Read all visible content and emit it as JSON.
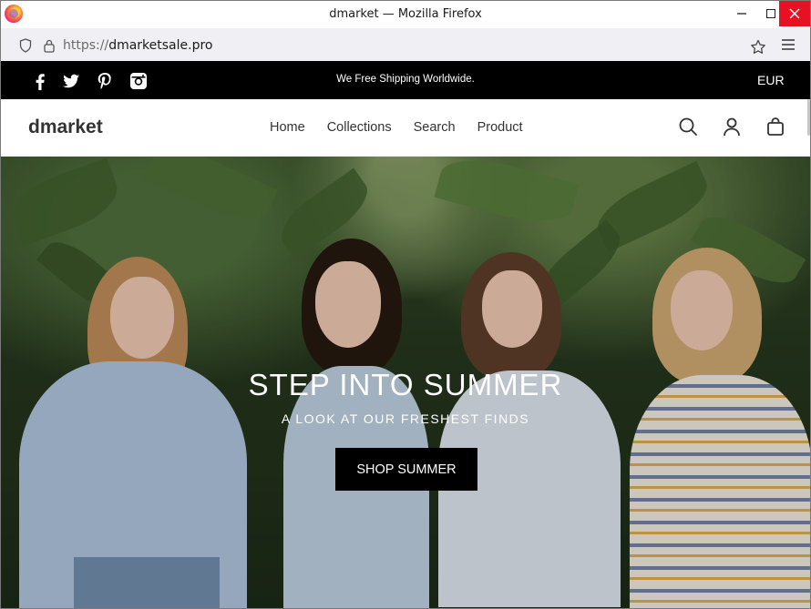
{
  "browser": {
    "window_title": "dmarket — Mozilla Firefox",
    "url_prefix": "https://",
    "url_host": "dmarketsale.pro"
  },
  "announcement": {
    "text": "We Free Shipping Worldwide.",
    "currency": "EUR",
    "social_icons": [
      "facebook-icon",
      "twitter-icon",
      "pinterest-icon",
      "instagram-icon"
    ]
  },
  "header": {
    "logo": "dmarket",
    "nav": [
      {
        "label": "Home"
      },
      {
        "label": "Collections"
      },
      {
        "label": "Search"
      },
      {
        "label": "Product"
      }
    ],
    "icons": [
      "search-icon",
      "account-icon",
      "cart-icon"
    ]
  },
  "hero": {
    "title": "STEP INTO SUMMER",
    "subtitle": "A LOOK AT OUR FRESHEST FINDS",
    "button": "SHOP SUMMER"
  },
  "colors": {
    "announcement_bg": "#000000",
    "button_bg": "#000000",
    "close_button": "#e81123"
  }
}
